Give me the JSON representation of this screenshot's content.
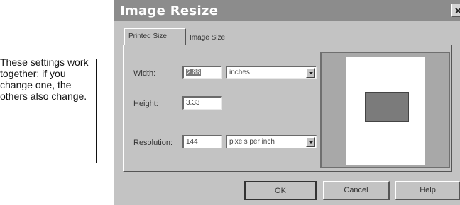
{
  "annotation": {
    "callout_text": "These settings work together: if you change one, the others also change."
  },
  "dialog": {
    "title": "Image Resize",
    "close_glyph": "✕",
    "tabs": [
      {
        "label": "Printed Size",
        "active": true
      },
      {
        "label": "Image Size",
        "active": false
      }
    ],
    "fields": {
      "width_label": "Width:",
      "width_value": "2.88",
      "width_unit": "inches",
      "height_label": "Height:",
      "height_value": "3.33",
      "resolution_label": "Resolution:",
      "resolution_value": "144",
      "resolution_unit": "pixels per inch"
    },
    "buttons": {
      "ok": "OK",
      "cancel": "Cancel",
      "help": "Help"
    }
  }
}
